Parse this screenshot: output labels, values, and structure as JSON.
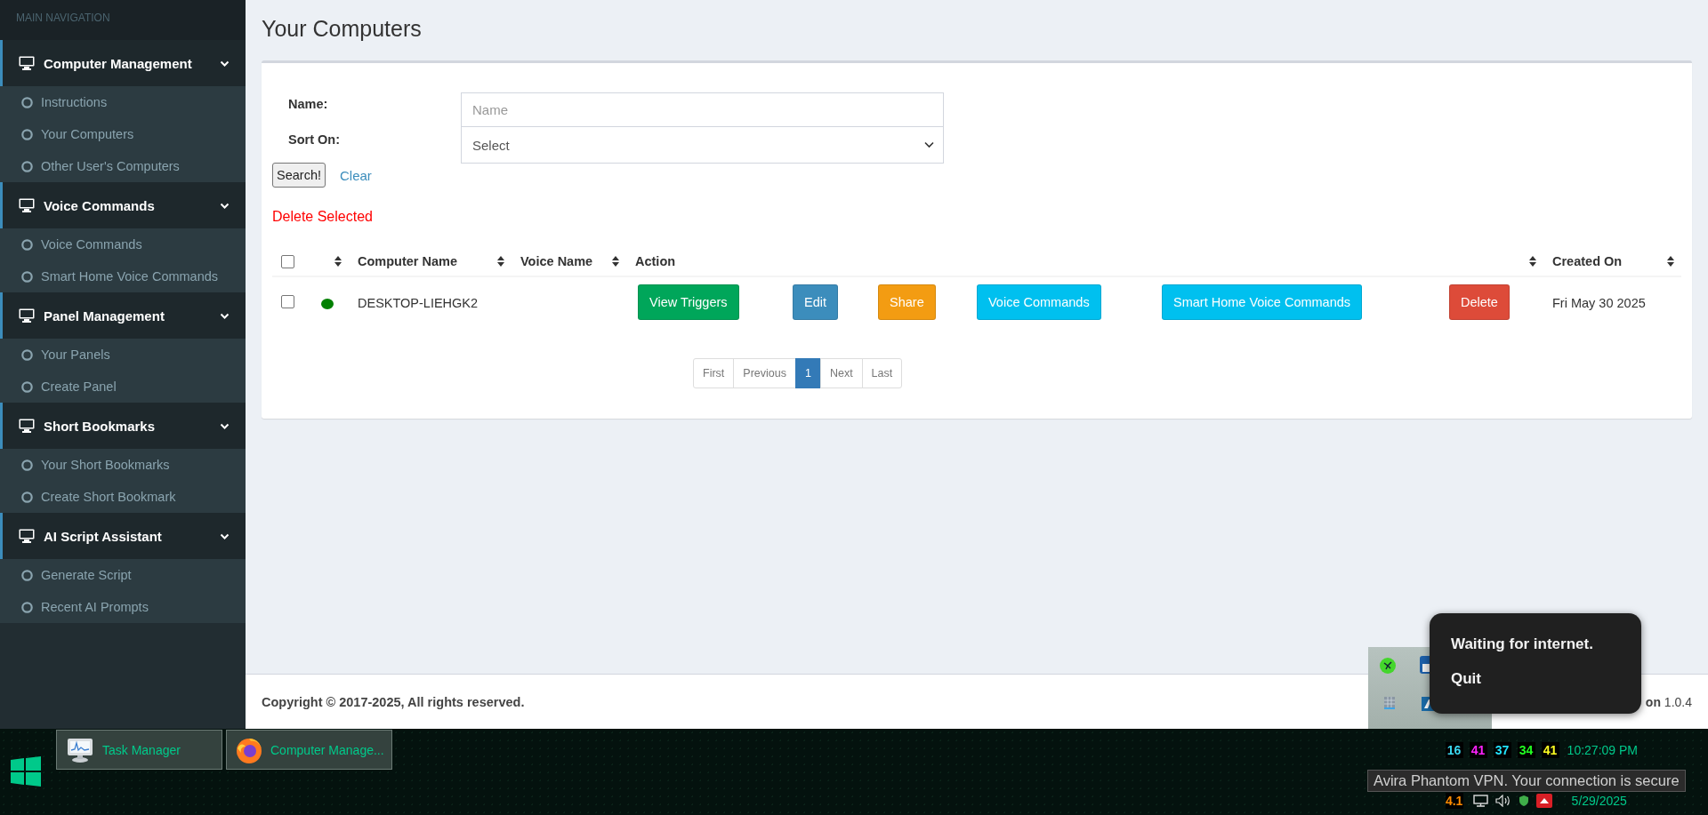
{
  "sidebar": {
    "heading": "MAIN NAVIGATION",
    "groups": [
      {
        "label": "Computer Management",
        "expanded": true,
        "items": [
          {
            "label": "Instructions"
          },
          {
            "label": "Your Computers"
          },
          {
            "label": "Other User's Computers"
          }
        ]
      },
      {
        "label": "Voice Commands",
        "expanded": true,
        "items": [
          {
            "label": "Voice Commands"
          },
          {
            "label": "Smart Home Voice Commands"
          }
        ]
      },
      {
        "label": "Panel Management",
        "expanded": true,
        "items": [
          {
            "label": "Your Panels"
          },
          {
            "label": "Create Panel"
          }
        ]
      },
      {
        "label": "Short Bookmarks",
        "expanded": true,
        "items": [
          {
            "label": "Your Short Bookmarks"
          },
          {
            "label": "Create Short Bookmark"
          }
        ]
      },
      {
        "label": "AI Script Assistant",
        "expanded": true,
        "items": [
          {
            "label": "Generate Script"
          },
          {
            "label": "Recent AI Prompts"
          }
        ]
      }
    ]
  },
  "page": {
    "title": "Your Computers"
  },
  "search_form": {
    "fields": [
      {
        "label": "Name:",
        "kind": "text",
        "placeholder": "Name"
      },
      {
        "label": "Sort On:",
        "kind": "select",
        "value": "Select"
      }
    ],
    "search_button": "Search!",
    "clear_link": "Clear"
  },
  "delete_selected": "Delete Selected",
  "table": {
    "columns": [
      {
        "kind": "checkbox",
        "checked": false
      },
      {
        "kind": "status",
        "sortable": true
      },
      {
        "kind": "text",
        "label": "Computer Name",
        "sortable": true
      },
      {
        "kind": "text",
        "label": "Voice Name",
        "sortable": true
      },
      {
        "kind": "text",
        "label": "Action",
        "sortable": true
      },
      {
        "kind": "text",
        "label": "Created On",
        "sortable": true
      }
    ],
    "rows": [
      {
        "checked": false,
        "online": true,
        "computer_name": "DESKTOP-LIEHGK2",
        "actions": [
          {
            "label": "View Triggers",
            "kind": "success"
          },
          {
            "label": "Edit",
            "kind": "primary"
          },
          {
            "label": "Share",
            "kind": "warning"
          },
          {
            "label": "Voice Commands",
            "kind": "info"
          },
          {
            "label": "Smart Home Voice Commands",
            "kind": "info"
          },
          {
            "label": "Delete",
            "kind": "danger"
          }
        ],
        "created_on": "Fri May 30 2025"
      }
    ]
  },
  "pagination": [
    {
      "label": "First",
      "selected": false
    },
    {
      "label": "Previous",
      "selected": false
    },
    {
      "label": "1",
      "selected": true
    },
    {
      "label": "Next",
      "selected": false
    },
    {
      "label": "Last",
      "selected": false
    }
  ],
  "footer": {
    "copyright": "Copyright © 2017-2025, All rights reserved.",
    "version": "**on** 1.0.4"
  },
  "popup_menu": {
    "items": [
      {
        "label": "Waiting for internet."
      },
      {
        "label": "Quit"
      }
    ]
  },
  "taskbar": {
    "tasks": [
      {
        "label": "Task Manager",
        "kind": "monitor"
      },
      {
        "label": "Computer Manage...",
        "kind": "browser"
      }
    ],
    "counters": [
      {
        "text": "16",
        "color": "#3ad8f0"
      },
      {
        "text": "41",
        "color": "#ff22ff"
      },
      {
        "text": "37",
        "color": "#22e5ff"
      },
      {
        "text": "34",
        "color": "#22ff22"
      },
      {
        "text": "41",
        "color": "#ffff22"
      }
    ],
    "time": "10:27:09 PM",
    "lower_counter": {
      "text": "4.1",
      "color": "#ff8c00"
    },
    "date": "5/29/2025"
  },
  "tooltip": "Avira Phantom VPN. Your connection is secure"
}
